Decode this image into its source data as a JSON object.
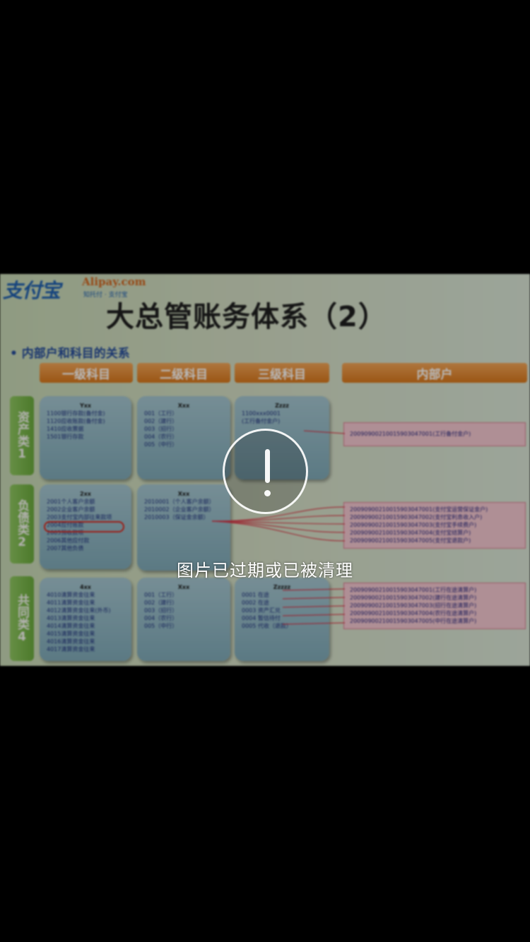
{
  "slide": {
    "logo": {
      "brand": "支付宝",
      "site": "Alipay.com",
      "tagline": "知托付 · 支付宝"
    },
    "title": "大总管账务体系（2）",
    "bullet": "内部户和科目的关系",
    "headers": [
      "一级科目",
      "二级科目",
      "三级科目",
      "内部户"
    ],
    "row_labels": [
      "资产类1",
      "负债类2",
      "共同类4"
    ],
    "rows": [
      {
        "level1": {
          "head": "Yxx",
          "lines": [
            "1100银行存款(备付金)",
            "1120应收账款(备付金)",
            "1410应收票据",
            "1501银行存款"
          ]
        },
        "level2": {
          "head": "Xxx",
          "lines": [
            "001（工行）",
            "002（建行）",
            "003（招行）",
            "004（农行）",
            "005（中行）"
          ]
        },
        "level3": {
          "head": "Zzzz",
          "lines": [
            "1100xxx0001",
            "(工行备付金户)"
          ]
        },
        "accounts": [
          "20090900210015903047001(工行备付金户)"
        ]
      },
      {
        "level1": {
          "head": "2xx",
          "lines": [
            "2001个人客户余额",
            "2002企业客户余额",
            "2003支付宝内部往来款项",
            "2004应付账款",
            "2005预收款项",
            "2006其他应付款",
            "2007其他负债"
          ]
        },
        "level2": {
          "head": "Xxx",
          "lines": [
            "2010001（个人客户余额）",
            "2010002（企业客户余额）",
            "2010003（保证金余额）"
          ]
        },
        "level3": null,
        "accounts": [
          "20090900210015903047001(支付宝运营保证金户)",
          "20090900210015903047002(支付宝利息收入户)",
          "20090900210015903047003(支付宝手续费户)",
          "20090900210015903047004(支付宝结算户)",
          "20090900210015903047005(支付宝退款户)"
        ]
      },
      {
        "level1": {
          "head": "4xx",
          "lines": [
            "4010清算资金往来",
            "4011清算资金往来",
            "4012清算资金往来(外币)",
            "4013清算资金往来",
            "4014清算资金往来",
            "4015清算资金往来",
            "4016清算资金往来",
            "4017清算资金往来"
          ]
        },
        "level2": {
          "head": "Xxx",
          "lines": [
            "001（工行）",
            "002（建行）",
            "003（招行）",
            "004（农行）",
            "005（中行）"
          ]
        },
        "level3": {
          "head": "Zzzzz",
          "lines": [
            "0001 在途",
            "0002 在途",
            "0003 资产汇兑",
            "0004 暂估待付",
            "0005 代收（退款）"
          ]
        },
        "accounts": [
          "20090900210015903047001(工行在途清算户)",
          "20090900210015903047002(建行在途清算户)",
          "20090900210015903047003(招行在途清算户)",
          "20090900210015903047004(农行在途清算户)",
          "20090900210015903047005(中行在途清算户)"
        ]
      }
    ]
  },
  "overlay": {
    "icon": "exclamation-circle-icon",
    "message": "图片已过期或已被清理"
  },
  "colors": {
    "background": "#000000",
    "slide_green": "#c7d7b4",
    "header_orange": "#e08a30",
    "row_label_green": "#7cb84e",
    "cell_blue": "#94b9c5",
    "account_pink": "#f3c6cf",
    "message_text": "#ffffff"
  }
}
